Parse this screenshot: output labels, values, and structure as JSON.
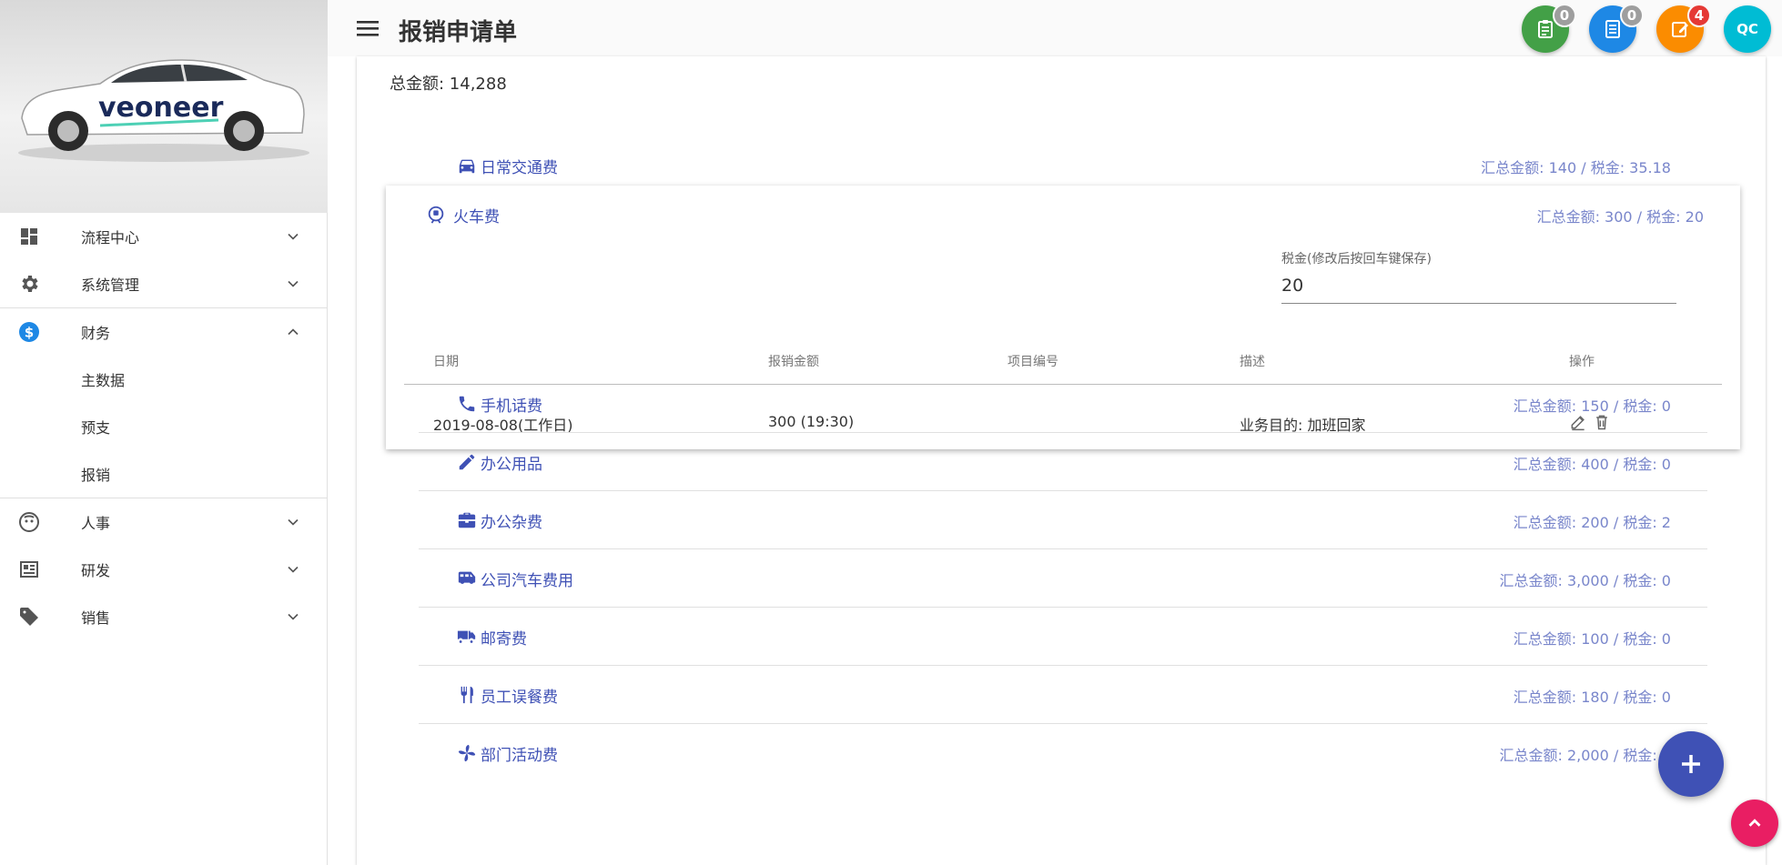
{
  "brand": {
    "logo_text": "veoneer"
  },
  "sidebar": {
    "items": [
      {
        "label": "流程中心",
        "icon": "dashboard-icon"
      },
      {
        "label": "系统管理",
        "icon": "gear-icon"
      },
      {
        "label": "财务",
        "icon": "dollar-icon",
        "expanded": true,
        "children": [
          {
            "label": "主数据"
          },
          {
            "label": "预支"
          },
          {
            "label": "报销"
          }
        ]
      },
      {
        "label": "人事",
        "icon": "face-icon"
      },
      {
        "label": "研发",
        "icon": "chip-icon"
      },
      {
        "label": "销售",
        "icon": "tag-icon"
      }
    ]
  },
  "header": {
    "title": "报销申请单",
    "badges": [
      {
        "icon": "clipboard-icon",
        "count": "0",
        "color": "#43a047",
        "badge_color": "#9e9e9e"
      },
      {
        "icon": "document-icon",
        "count": "0",
        "color": "#1e88e5",
        "badge_color": "#9e9e9e"
      },
      {
        "icon": "edit-note-icon",
        "count": "4",
        "color": "#fb8c00",
        "badge_color": "#e53935"
      }
    ],
    "avatar": "QC",
    "avatar_color": "#00bcd4"
  },
  "main": {
    "total": "总金额: 14,288",
    "categories_top": [
      {
        "label": "日常交通费",
        "icon": "car-icon",
        "summary": "汇总金额: 140 / 税金: 35.18"
      }
    ],
    "expanded": {
      "label": "火车费",
      "icon": "train-icon",
      "summary": "汇总金额: 300 / 税金: 20",
      "tax_label": "税金(修改后按回车键保存)",
      "tax_value": "20",
      "columns": [
        "日期",
        "报销金额",
        "项目编号",
        "描述",
        "操作"
      ],
      "rows": [
        {
          "date": "2019-08-08(工作日)",
          "amount": "300 (19:30)",
          "project": "",
          "desc": "业务目的: 加班回家"
        }
      ]
    },
    "categories": [
      {
        "label": "手机话费",
        "icon": "phone-icon",
        "summary": "汇总金额: 150 / 税金: 0"
      },
      {
        "label": "办公用品",
        "icon": "pencil-icon",
        "summary": "汇总金额: 400 / 税金: 0"
      },
      {
        "label": "办公杂费",
        "icon": "toolbox-icon",
        "summary": "汇总金额: 200 / 税金: 2"
      },
      {
        "label": "公司汽车费用",
        "icon": "bus-icon",
        "summary": "汇总金额: 3,000 / 税金: 0"
      },
      {
        "label": "邮寄费",
        "icon": "truck-icon",
        "summary": "汇总金额: 100 / 税金: 0"
      },
      {
        "label": "员工误餐费",
        "icon": "utensils-icon",
        "summary": "汇总金额: 180 / 税金: 0"
      },
      {
        "label": "部门活动费",
        "icon": "pinwheel-icon",
        "summary": "汇总金额: 2,000 / 税金: 0"
      }
    ]
  },
  "colors": {
    "primary": "#3f51b5",
    "primary_light": "#7986cb",
    "fab_up": "#e91e63"
  }
}
